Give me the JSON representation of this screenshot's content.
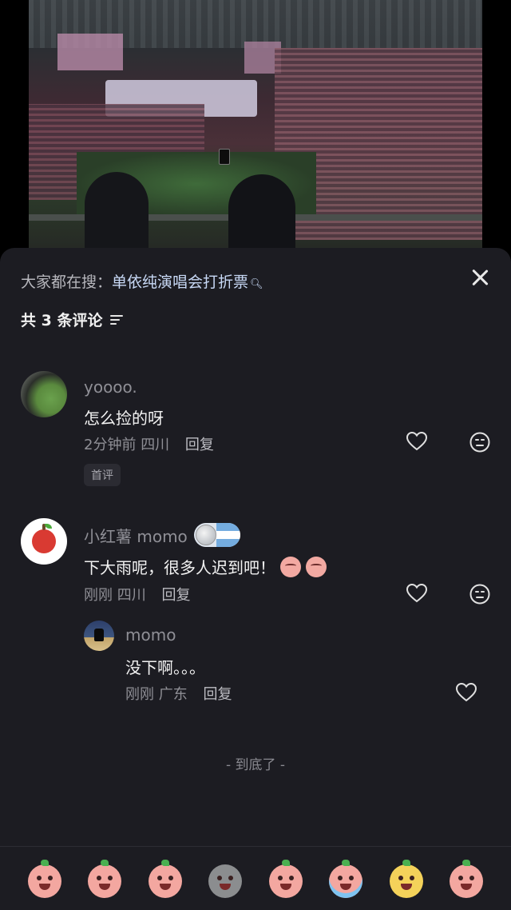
{
  "photo": {
    "alt": ""
  },
  "sheet": {
    "search_prefix": "大家都在搜：",
    "search_keyword": "单依纯演唱会打折票",
    "comment_count_label": "共 3 条评论"
  },
  "comments": [
    {
      "username": "yoooo.",
      "text": "怎么捡的呀",
      "time": "2分钟前",
      "location": "四川",
      "reply_label": "回复",
      "badge": "首评"
    },
    {
      "username": "小红薯 momo",
      "text": "下大雨呢，很多人迟到吧！",
      "time": "刚刚",
      "location": "四川",
      "reply_label": "回复"
    },
    {
      "username": "momo",
      "text": "没下啊。。。",
      "time": "刚刚",
      "location": "广东",
      "reply_label": "回复"
    }
  ],
  "end_text": "- 到底了 -",
  "icons": {
    "close": "close-icon",
    "filter": "filter-icon",
    "like": "heart-icon",
    "emoji_reply": "emoji-face-icon",
    "search": "search-icon"
  },
  "emoji_bar": [
    "crying-face",
    "sweating-shock-face",
    "giggling-face",
    "grey-shocked-face",
    "sad-pouting-face",
    "blue-crying-face",
    "yellow-dog-face",
    "kiss-face"
  ],
  "colors": {
    "sheet_bg": "#1c1c22",
    "keyword": "#c8d9f6",
    "muted_text": "#8f8f96"
  }
}
